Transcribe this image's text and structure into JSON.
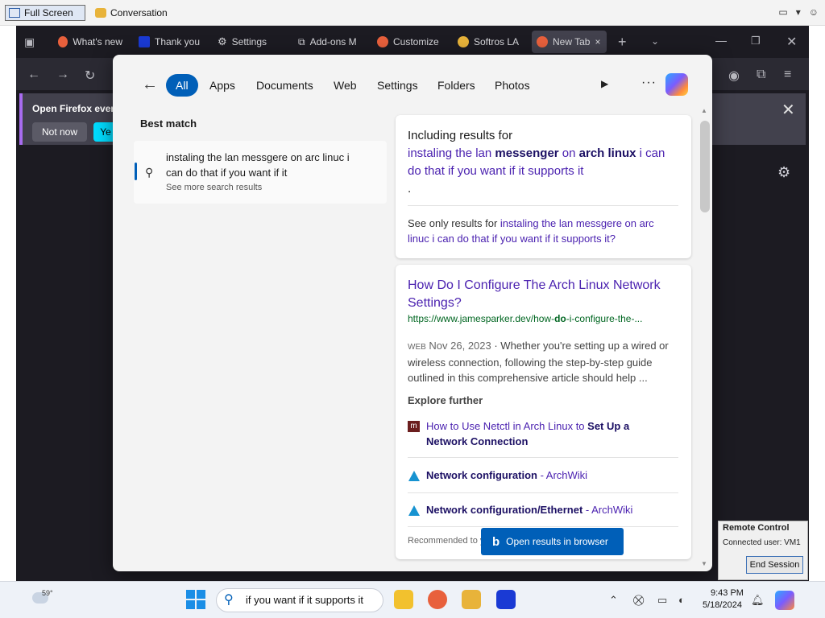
{
  "remote_bar": {
    "full_screen_label": "Full Screen",
    "conversation_label": "Conversation"
  },
  "browser": {
    "tabs": [
      {
        "label": "What's new",
        "icon": "firefox-icon"
      },
      {
        "label": "Thank you",
        "icon": "malwarebytes-icon"
      },
      {
        "label": "Settings",
        "icon": "gear-icon"
      },
      {
        "label": "Add-ons M",
        "icon": "puzzle-icon"
      },
      {
        "label": "Customize",
        "icon": "firefox-icon"
      },
      {
        "label": "Softros LA",
        "icon": "chat-icon"
      },
      {
        "label": "New Tab",
        "icon": "firefox-icon",
        "active": true
      }
    ],
    "notice": {
      "text": "Open Firefox ever",
      "not_now": "Not now",
      "yes": "Ye"
    }
  },
  "search": {
    "filters": [
      "All",
      "Apps",
      "Documents",
      "Web",
      "Settings",
      "Folders",
      "Photos"
    ],
    "selected_filter": "All",
    "best_match": {
      "heading": "Best match",
      "query": "instaling the lan messgere on arc linuc i can do that if you want if it",
      "see_more": "See more search results"
    },
    "correction": {
      "label": "Including results for",
      "corrected_parts": [
        "instaling the lan ",
        "messenger",
        " on ",
        "arch linux",
        " i can do that if you want if it supports it"
      ],
      "trailing": ".",
      "see_only_prefix": "See only results for ",
      "see_only_query": "instaling the lan messgere on arc linuc i can do that if you want if it supports it?"
    },
    "result": {
      "title": "How Do I Configure The Arch Linux Network Settings?",
      "url_prefix": "https://www.jamesparker.dev/how-",
      "url_bold": "do",
      "url_suffix": "-i-configure-the-...",
      "source_tag": "WEB",
      "date": "Nov 26, 2023",
      "snippet": " · Whether you're setting up a wired or wireless connection, following the step-by-step guide outlined in this comprehensive article should help ..."
    },
    "explore": {
      "heading": "Explore further",
      "items": [
        {
          "normal": "How to Use Netctl in Arch Linux to ",
          "bold": "Set Up a Network Connection",
          "site": ""
        },
        {
          "normal": "",
          "bold": "Network configuration",
          "site": " - ArchWiki"
        },
        {
          "normal": "",
          "bold": "Network configuration/Ethernet",
          "site": " - ArchWiki"
        }
      ]
    },
    "recommended_text": "Recommended to y",
    "open_in_browser": "Open results in browser"
  },
  "remote_popup": {
    "title": "Remote Control",
    "user": "Connected user: VM1",
    "end_session": "End Session"
  },
  "taskbar": {
    "weather_temp": "59°",
    "search_value": "if you want if it supports it",
    "time": "9:43 PM",
    "date": "5/18/2024"
  },
  "colors": {
    "accent": "#005fb8",
    "link": "#4b22b0",
    "url": "#006621"
  }
}
